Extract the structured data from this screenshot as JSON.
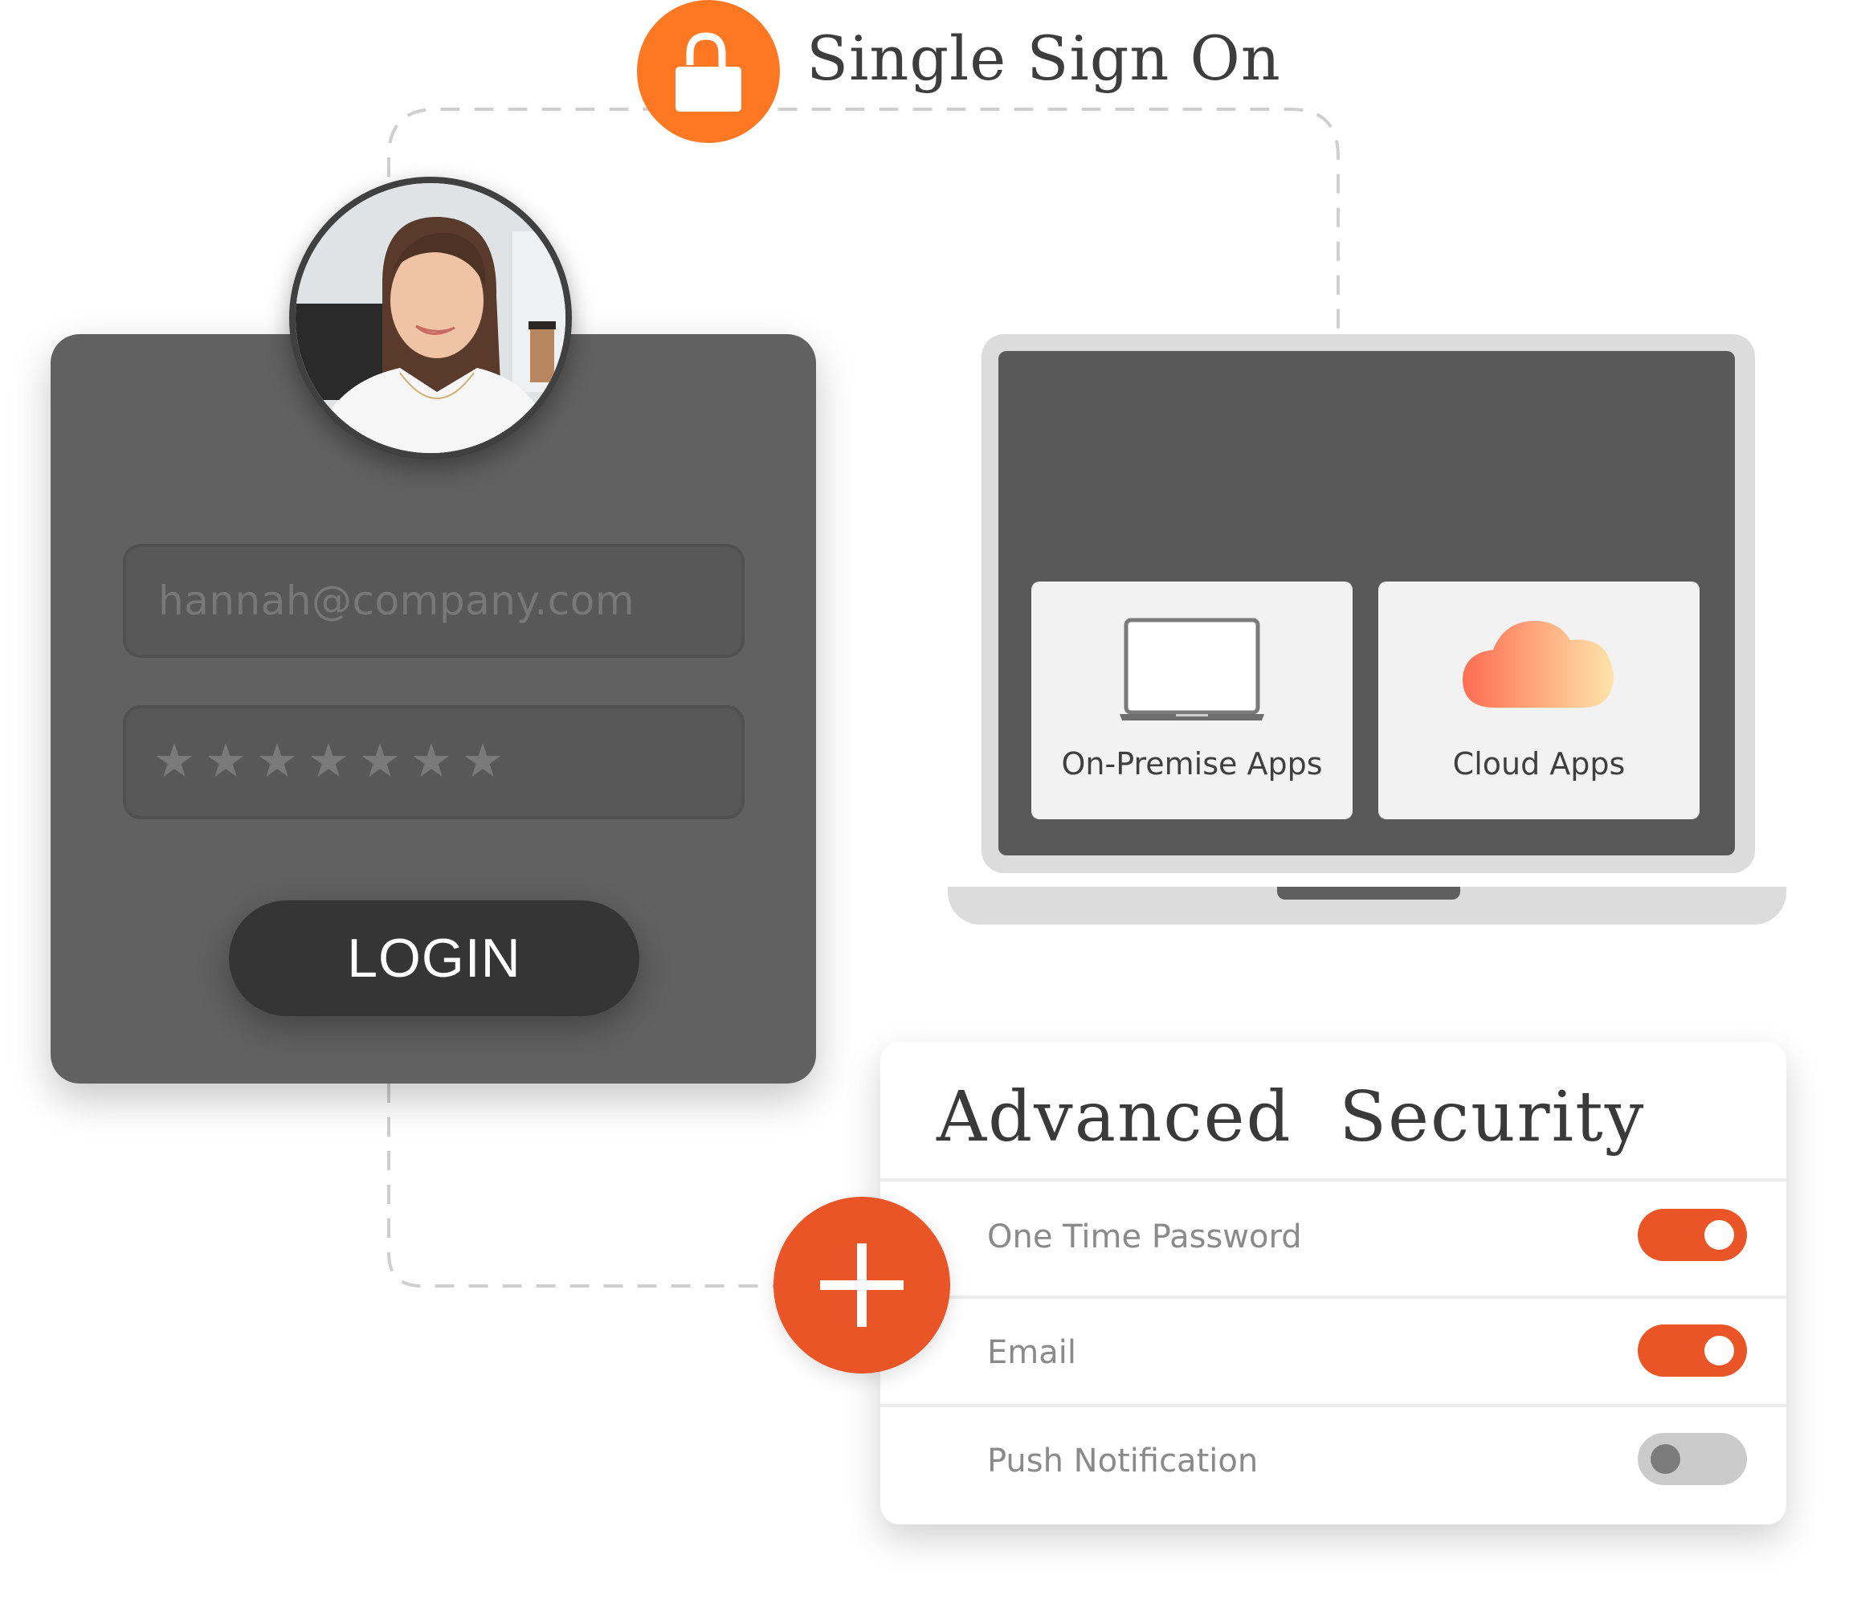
{
  "header": {
    "title": "Single Sign On",
    "icon": "unlocked-padlock-icon",
    "accent_color": "#fe7722"
  },
  "login_card": {
    "avatar_alt": "User profile photo of a smiling woman",
    "email_value": "hannah@company.com",
    "password_mask": "★★★★★★★",
    "password_length": 7,
    "login_button_label": "LOGIN"
  },
  "laptop": {
    "tiles": [
      {
        "label": "On-Premise Apps",
        "icon": "laptop-icon"
      },
      {
        "label": "Cloud Apps",
        "icon": "cloud-icon"
      }
    ]
  },
  "security": {
    "title": "Advanced  Security",
    "add_icon": "plus-icon",
    "accent_color": "#ea5527",
    "options": [
      {
        "label": "One Time Password",
        "enabled": true
      },
      {
        "label": "Email",
        "enabled": true
      },
      {
        "label": "Push Notification",
        "enabled": false
      }
    ]
  }
}
